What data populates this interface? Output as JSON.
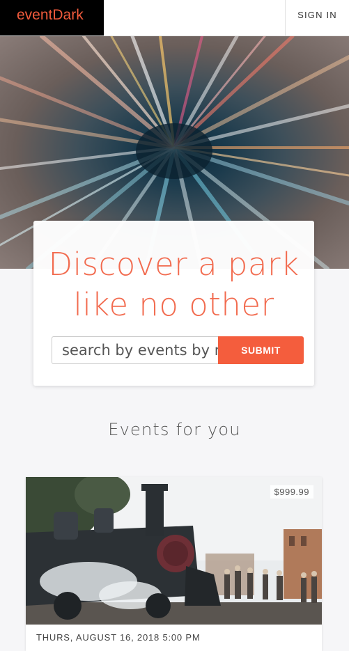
{
  "header": {
    "brand": "eventDark",
    "sign_in_label": "SIGN IN"
  },
  "hero": {
    "headline_line1": "Discover a park",
    "headline_line2": "like no other",
    "search_placeholder": "search by events by name",
    "submit_label": "SUBMIT"
  },
  "events_section": {
    "title": "Events for you",
    "events": [
      {
        "price": "$999.99",
        "date": "THURS, AUGUST 16, 2018 5:00 PM"
      }
    ]
  },
  "colors": {
    "accent": "#f45d3d",
    "brand_bg": "#000000",
    "page_bg": "#f6f6f8"
  }
}
